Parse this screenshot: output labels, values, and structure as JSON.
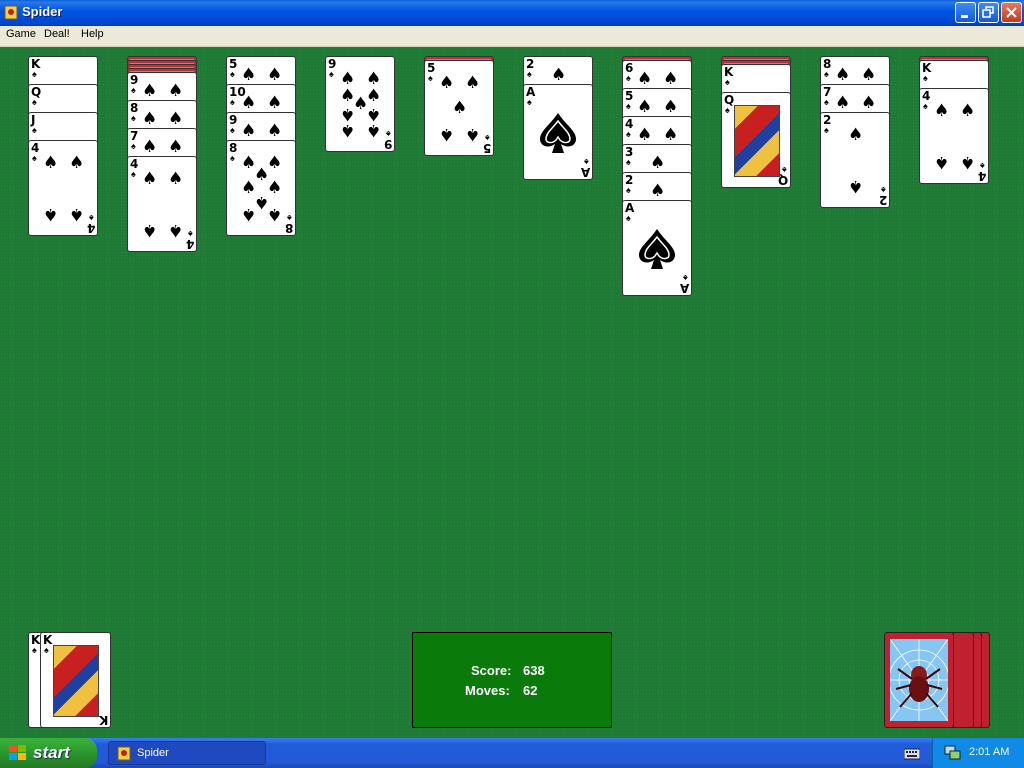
{
  "window": {
    "title": "Spider"
  },
  "menu": {
    "game": "Game",
    "deal": "Deal!",
    "help": "Help"
  },
  "score": {
    "score_label": "Score:",
    "score_value": "638",
    "moves_label": "Moves:",
    "moves_value": "62"
  },
  "taskbar": {
    "start_label": "start",
    "task_label": "Spider",
    "clock": "2:01 AM"
  },
  "foundation": {
    "rank": "K",
    "suit": "♠"
  },
  "colors": {
    "felt": "#1d7a33",
    "card_back": "#c0303a",
    "title_bar": "#0055e5",
    "score_box": "#0a7a0a"
  },
  "tableau": [
    {
      "face_down": 0,
      "cards": [
        "K",
        "Q",
        "J",
        "4"
      ]
    },
    {
      "face_down": 4,
      "cards": [
        "9",
        "8",
        "7",
        "4"
      ]
    },
    {
      "face_down": 0,
      "cards": [
        "5",
        "10",
        "9",
        "8"
      ]
    },
    {
      "face_down": 0,
      "cards": [
        "9"
      ]
    },
    {
      "face_down": 1,
      "cards": [
        "5"
      ]
    },
    {
      "face_down": 0,
      "cards": [
        "2",
        "A"
      ]
    },
    {
      "face_down": 1,
      "cards": [
        "6",
        "5",
        "4",
        "3",
        "2",
        "A"
      ]
    },
    {
      "face_down": 2,
      "cards": [
        "K",
        "Q"
      ]
    },
    {
      "face_down": 0,
      "cards": [
        "8",
        "7",
        "2"
      ]
    },
    {
      "face_down": 1,
      "cards": [
        "K",
        "4"
      ]
    }
  ],
  "suit": "♠"
}
